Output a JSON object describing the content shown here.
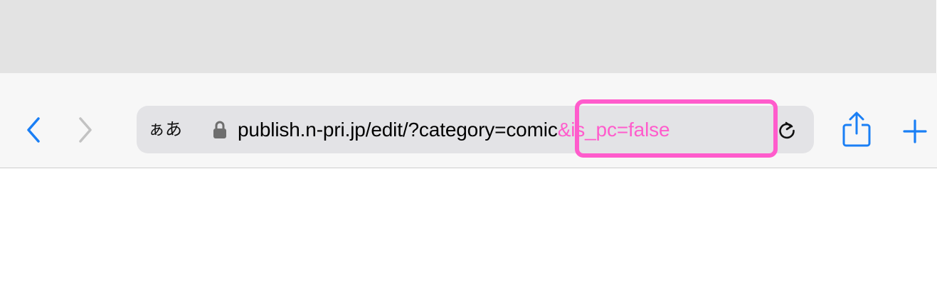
{
  "toolbar": {
    "reader_label": "ぁあ",
    "url_main": "publish.n-pri.jp/edit/?category=comic",
    "url_highlight": "&is_pc=false"
  },
  "icons": {
    "back": "chevron-left-icon",
    "forward": "chevron-right-icon",
    "lock": "lock-icon",
    "reload": "reload-icon",
    "share": "share-icon",
    "new_tab": "plus-icon"
  },
  "colors": {
    "accent": "#1a7ff5",
    "disabled": "#c2c2c2",
    "highlight": "#ff5ccc",
    "url_bar": "#e3e3e6",
    "toolbar_bg": "#f7f7f7",
    "top_bg": "#e3e3e3"
  }
}
